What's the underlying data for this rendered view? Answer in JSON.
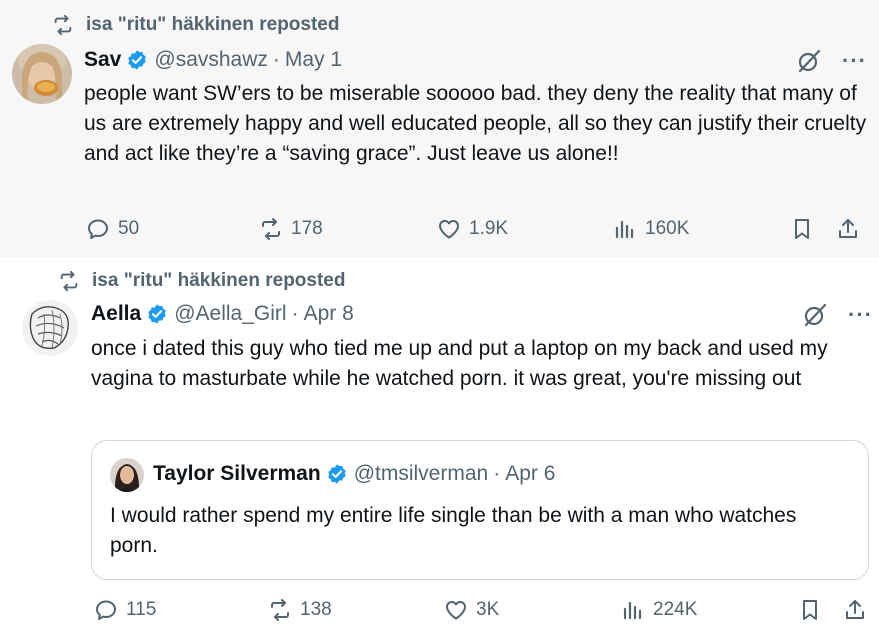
{
  "tweets": [
    {
      "repost_label": "isa \"ritu\" häkkinen reposted",
      "name": "Sav",
      "handle": "@savshawz",
      "date": "May 1",
      "text": "people want SW’ers to be miserable sooooo bad.   they deny the reality that many of us are extremely happy and well educated people, all so they can justify their cruelty and act like they’re a “saving grace”.  Just leave us alone!!",
      "replies": "50",
      "reposts": "178",
      "likes": "1.9K",
      "views": "160K"
    },
    {
      "repost_label": "isa \"ritu\" häkkinen reposted",
      "name": "Aella",
      "handle": "@Aella_Girl",
      "date": "Apr 8",
      "text": "once i dated this guy who tied me up and put a laptop on my back and used my vagina to masturbate while he watched porn. it was great, you're missing out",
      "quote": {
        "name": "Taylor Silverman",
        "handle": "@tmsilverman",
        "date": "Apr 6",
        "text": "I would rather spend my entire life single than be with a man who watches porn."
      },
      "replies": "115",
      "reposts": "138",
      "likes": "3K",
      "views": "224K"
    }
  ],
  "colors": {
    "verified": "#1d9bf0",
    "secondary_text": "#536471",
    "primary_text": "#0f1419"
  },
  "icons": [
    "repost-icon",
    "verified-badge-icon",
    "grok-icon",
    "more-icon",
    "reply-icon",
    "like-icon",
    "views-icon",
    "bookmark-icon",
    "share-icon"
  ]
}
